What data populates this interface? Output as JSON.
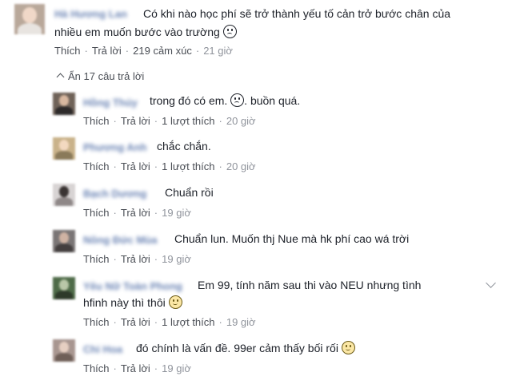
{
  "post": {
    "comment": {
      "author": "Hà Hương Lan",
      "text_line1": "Có khi nào học phí sẽ trở thành yếu tố cản trở bước chân của",
      "text_line2": "nhiều em muốn bước vào trường",
      "emoji": "sad-face-icon",
      "like_label": "Thích",
      "reply_label": "Trả lời",
      "reactions": "219 cảm xúc",
      "time": "21 giờ"
    },
    "replies_toggle": "Ẩn 17 câu trả lời"
  },
  "replies": [
    {
      "author": "Hồng Thúy",
      "text": "trong đó có em.",
      "text_after": ". buồn quá.",
      "emoji": "sad-face-icon",
      "like": "Thích",
      "reply": "Trả lời",
      "likes": "1 lượt thích",
      "time": "20 giờ"
    },
    {
      "author": "Phương Anh",
      "text": "chắc chắn.",
      "like": "Thích",
      "reply": "Trả lời",
      "likes": "1 lượt thích",
      "time": "20 giờ"
    },
    {
      "author": "Bạch Dương",
      "text": "Chuẩn rồi",
      "like": "Thích",
      "reply": "Trả lời",
      "time": "19 giờ"
    },
    {
      "author": "Nông Đức Mùa",
      "text": "Chuẩn lun. Muốn thj Nue mà hk phí cao wá trời",
      "like": "Thích",
      "reply": "Trả lời",
      "time": "19 giờ"
    },
    {
      "author": "Yêu Nữ Toàn Phong",
      "text_line1": "Em 99, tính năm sau thi vào NEU nhưng tình",
      "text_line2": "hfinh này thì thôi",
      "emoji": "smile-face-icon",
      "like": "Thích",
      "reply": "Trả lời",
      "likes": "1 lượt thích",
      "time": "19 giờ"
    },
    {
      "author": "Chi Hoa",
      "text": "đó chính là vấn đề. 99er cảm thấy bối rối",
      "emoji": "smile-face-icon",
      "like": "Thích",
      "reply": "Trả lời",
      "time": "19 giờ"
    }
  ],
  "colors": {
    "link": "#365899",
    "meta": "#90949c",
    "text": "#1d2129"
  }
}
